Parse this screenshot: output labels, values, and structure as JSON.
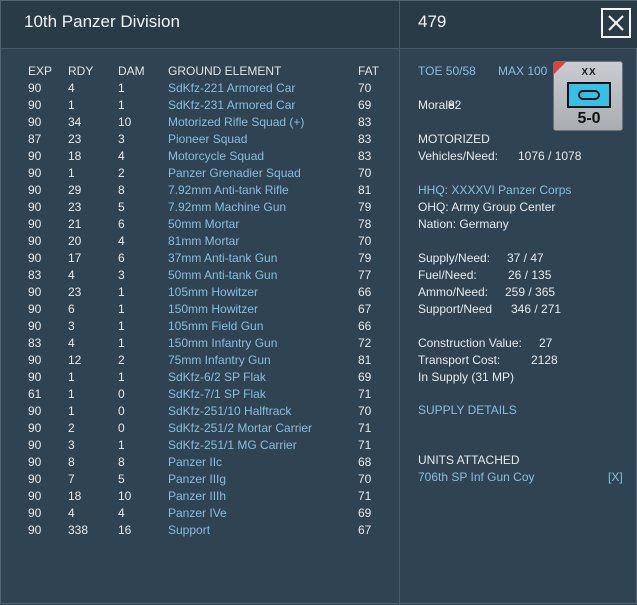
{
  "window": {
    "title": "10th Panzer Division",
    "unit_id": "479",
    "close_label": "close"
  },
  "table": {
    "headers": {
      "exp": "EXP",
      "rdy": "RDY",
      "dam": "DAM",
      "name": "GROUND ELEMENT",
      "fat": "FAT"
    },
    "rows": [
      {
        "exp": "90",
        "rdy": "4",
        "dam": "1",
        "name": "SdKfz-221 Armored Car",
        "fat": "70"
      },
      {
        "exp": "90",
        "rdy": "1",
        "dam": "1",
        "name": "SdKfz-231 Armored Car",
        "fat": "69"
      },
      {
        "exp": "90",
        "rdy": "34",
        "dam": "10",
        "name": "Motorized Rifle Squad (+)",
        "fat": "83"
      },
      {
        "exp": "87",
        "rdy": "23",
        "dam": "3",
        "name": "Pioneer Squad",
        "fat": "83"
      },
      {
        "exp": "90",
        "rdy": "18",
        "dam": "4",
        "name": "Motorcycle Squad",
        "fat": "83"
      },
      {
        "exp": "90",
        "rdy": "1",
        "dam": "2",
        "name": "Panzer Grenadier Squad",
        "fat": "70"
      },
      {
        "exp": "90",
        "rdy": "29",
        "dam": "8",
        "name": "7.92mm Anti-tank Rifle",
        "fat": "81"
      },
      {
        "exp": "90",
        "rdy": "23",
        "dam": "5",
        "name": "7.92mm Machine Gun",
        "fat": "79"
      },
      {
        "exp": "90",
        "rdy": "21",
        "dam": "6",
        "name": "50mm Mortar",
        "fat": "78"
      },
      {
        "exp": "90",
        "rdy": "20",
        "dam": "4",
        "name": "81mm Mortar",
        "fat": "70"
      },
      {
        "exp": "90",
        "rdy": "17",
        "dam": "6",
        "name": "37mm Anti-tank Gun",
        "fat": "79"
      },
      {
        "exp": "83",
        "rdy": "4",
        "dam": "3",
        "name": "50mm Anti-tank Gun",
        "fat": "77"
      },
      {
        "exp": "90",
        "rdy": "23",
        "dam": "1",
        "name": "105mm Howitzer",
        "fat": "66"
      },
      {
        "exp": "90",
        "rdy": "6",
        "dam": "1",
        "name": "150mm Howitzer",
        "fat": "67"
      },
      {
        "exp": "90",
        "rdy": "3",
        "dam": "1",
        "name": "105mm Field Gun",
        "fat": "66"
      },
      {
        "exp": "83",
        "rdy": "4",
        "dam": "1",
        "name": "150mm Infantry Gun",
        "fat": "72"
      },
      {
        "exp": "90",
        "rdy": "12",
        "dam": "2",
        "name": "75mm Infantry Gun",
        "fat": "81"
      },
      {
        "exp": "90",
        "rdy": "1",
        "dam": "1",
        "name": "SdKfz-6/2 SP Flak",
        "fat": "69"
      },
      {
        "exp": "61",
        "rdy": "1",
        "dam": "0",
        "name": "SdKfz-7/1 SP Flak",
        "fat": "71"
      },
      {
        "exp": "90",
        "rdy": "1",
        "dam": "0",
        "name": "SdKfz-251/10 Halftrack",
        "fat": "70"
      },
      {
        "exp": "90",
        "rdy": "2",
        "dam": "0",
        "name": "SdKfz-251/2 Mortar Carrier",
        "fat": "71"
      },
      {
        "exp": "90",
        "rdy": "3",
        "dam": "1",
        "name": "SdKfz-251/1 MG Carrier",
        "fat": "71"
      },
      {
        "exp": "90",
        "rdy": "8",
        "dam": "8",
        "name": "Panzer IIc",
        "fat": "68"
      },
      {
        "exp": "90",
        "rdy": "7",
        "dam": "5",
        "name": "Panzer IIIg",
        "fat": "70"
      },
      {
        "exp": "90",
        "rdy": "18",
        "dam": "10",
        "name": "Panzer IIIh",
        "fat": "71"
      },
      {
        "exp": "90",
        "rdy": "4",
        "dam": "4",
        "name": "Panzer IVe",
        "fat": "69"
      },
      {
        "exp": "90",
        "rdy": "338",
        "dam": "16",
        "name": "Support",
        "fat": "67"
      }
    ]
  },
  "panel": {
    "toe": "TOE 50/58",
    "max": "MAX 100",
    "morale_label": "Morale:",
    "morale_value": "82",
    "unit_type": "MOTORIZED",
    "vehicles_label": "Vehicles/Need:",
    "vehicles_value": "1076 / 1078",
    "hhq": "HHQ: XXXXVI Panzer Corps",
    "ohq": "OHQ: Army Group Center",
    "nation": "Nation:  Germany",
    "supply_label": "Supply/Need:",
    "supply_value": "37 / 47",
    "fuel_label": "Fuel/Need:",
    "fuel_value": "26 / 135",
    "ammo_label": "Ammo/Need:",
    "ammo_value": "259 / 365",
    "support_label": "Support/Need",
    "support_value": "346 / 271",
    "construction_label": "Construction Value:",
    "construction_value": "27",
    "transport_label": "Transport Cost:",
    "transport_value": "2128",
    "in_supply": "In Supply (31 MP)",
    "supply_details": "SUPPLY DETAILS",
    "units_attached_title": "UNITS ATTACHED",
    "attached_unit": "706th SP Inf Gun Coy",
    "detach_label": "[X]"
  },
  "counter": {
    "size": "XX",
    "strength": "5-0",
    "flag_color": "#e0413b",
    "symbol_color": "#33c2e6",
    "symbol_icon": "motorized-armor-icon"
  }
}
